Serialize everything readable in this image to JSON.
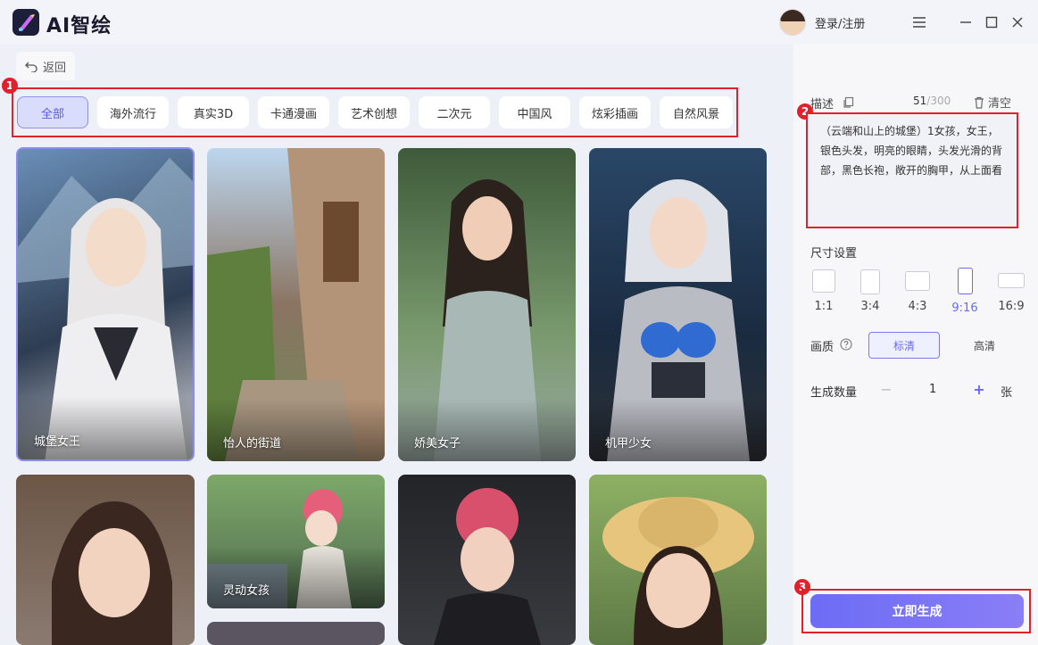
{
  "app": {
    "title": "AI智绘",
    "login_label": "登录/注册"
  },
  "nav": {
    "back_label": "返回"
  },
  "categories": [
    {
      "label": "全部",
      "active": true
    },
    {
      "label": "海外流行"
    },
    {
      "label": "真实3D"
    },
    {
      "label": "卡通漫画"
    },
    {
      "label": "艺术创想"
    },
    {
      "label": "二次元"
    },
    {
      "label": "中国风"
    },
    {
      "label": "炫彩插画"
    },
    {
      "label": "自然风景"
    }
  ],
  "gallery": [
    {
      "label": "城堡女王",
      "selected": true
    },
    {
      "label": "怡人的街道"
    },
    {
      "label": "娇美女子"
    },
    {
      "label": "机甲少女"
    },
    {
      "label": ""
    },
    {
      "label": "灵动女孩"
    },
    {
      "label": ""
    },
    {
      "label": ""
    },
    {
      "label": ""
    }
  ],
  "description": {
    "label": "描述",
    "count": "51",
    "max": "/300",
    "clear_label": "清空",
    "text": "（云端和山上的城堡）1女孩，女王，银色头发，明亮的眼睛，头发光滑的背部，黑色长袍，敞开的胸甲，从上面看"
  },
  "size": {
    "label": "尺寸设置",
    "options": [
      "1:1",
      "3:4",
      "4:3",
      "9:16",
      "16:9"
    ],
    "selected": "9:16"
  },
  "quality": {
    "label": "画质",
    "help_icon": "question-circle-icon",
    "options": [
      "标清",
      "高清"
    ],
    "selected": "标清"
  },
  "quantity": {
    "label": "生成数量",
    "value": "1",
    "unit": "张",
    "minus": "−",
    "plus": "+"
  },
  "generate_label": "立即生成",
  "annotations": [
    "1",
    "2",
    "3"
  ],
  "colors": {
    "accent": "#6c6cf4",
    "annotation": "#e0202a"
  }
}
